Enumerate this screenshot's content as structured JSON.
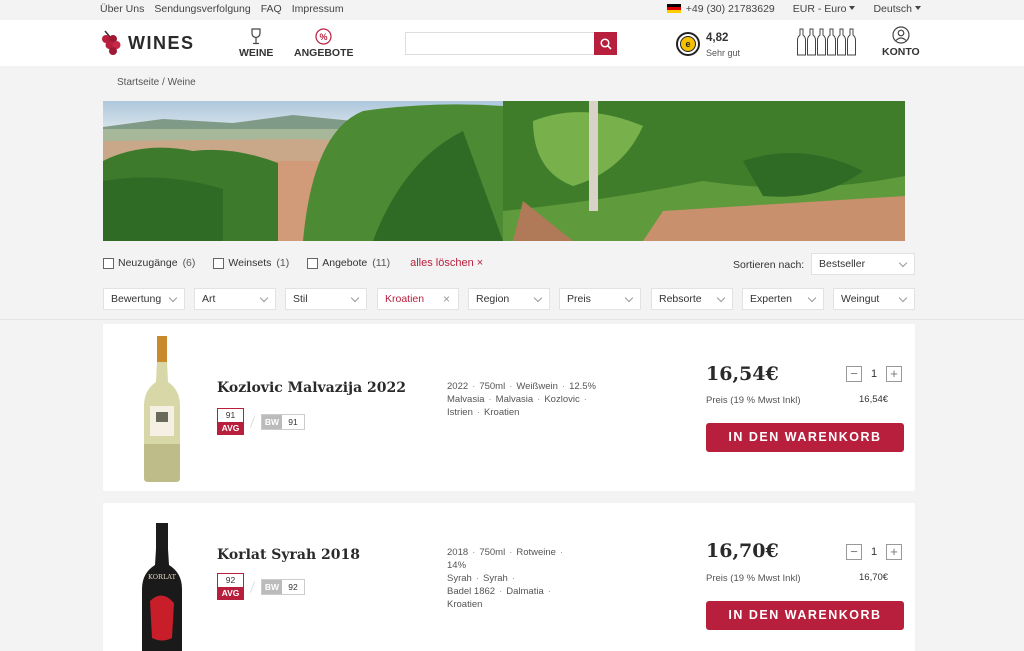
{
  "topbar": {
    "links": [
      "Über Uns",
      "Sendungsverfolgung",
      "FAQ",
      "Impressum"
    ],
    "phone": "+49 (30) 21783629",
    "currency": "EUR - Euro",
    "language": "Deutsch"
  },
  "header": {
    "logo_text": "WINES",
    "nav": {
      "weine": "WEINE",
      "angebote": "ANGEBOTE"
    },
    "search_placeholder": "",
    "rating": {
      "score": "4,82",
      "label": "Sehr gut",
      "seal": "e"
    },
    "account": "KONTO"
  },
  "breadcrumb": "Startseite / Weine",
  "filters": {
    "quick": [
      {
        "label": "Neuzugänge",
        "count": "(6)"
      },
      {
        "label": "Weinsets",
        "count": "(1)"
      },
      {
        "label": "Angebote",
        "count": "(11)"
      }
    ],
    "clear_all": "alles löschen ×",
    "sort_label": "Sortieren nach:",
    "sort_value": "Bestseller",
    "dropdowns": [
      "Bewertung",
      "Art",
      "Stil",
      "Kroatien",
      "Region",
      "Preis",
      "Rebsorte",
      "Experten",
      "Weingut"
    ]
  },
  "products": [
    {
      "name": "Kozlovic Malvazija 2022",
      "score": "91",
      "score_label": "AVG",
      "bw_label": "BW",
      "bw_score": "91",
      "details": [
        "2022",
        "750ml",
        "Weißwein",
        "12.5%",
        "Malvasia",
        "Malvasia",
        "Kozlovic",
        "Istrien",
        "Kroatien"
      ],
      "price": "16,54€",
      "price_note": "Preis (19 % Mwst Inkl)",
      "price_small": "16,54€",
      "qty": "1",
      "cart": "IN DEN WARENKORB"
    },
    {
      "name": "Korlat Syrah 2018",
      "score": "92",
      "score_label": "AVG",
      "bw_label": "BW",
      "bw_score": "92",
      "details": [
        "2018",
        "750ml",
        "Rotweine",
        "14%",
        "Syrah",
        "Syrah",
        "Badel 1862",
        "Dalmatia",
        "Kroatien"
      ],
      "price": "16,70€",
      "price_note": "Preis (19 % Mwst Inkl)",
      "price_small": "16,70€",
      "qty": "1",
      "cart": "IN DEN WARENKORB",
      "label_text": "KORLAT"
    }
  ],
  "colors": {
    "accent": "#b81f3d",
    "background": "#f3f3f3"
  }
}
